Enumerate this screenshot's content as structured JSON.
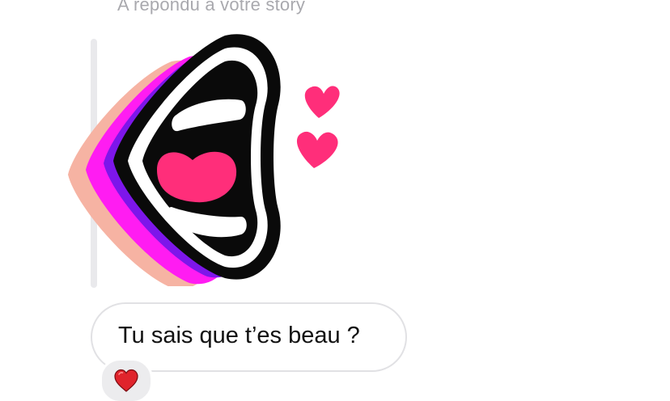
{
  "story_reply": {
    "caption": "A répondu à votre story"
  },
  "sticker": {
    "icon": "open-mouth-heart-sticker-icon",
    "colors": {
      "black": "#0a0a0a",
      "tongue": "#ff2e7a",
      "purple": "#7d16ea",
      "magenta": "#ff1cf2",
      "peach": "#f6b3a3",
      "hearts": "#ff2e7a"
    }
  },
  "message": {
    "text": "Tu sais que t’es beau ?"
  },
  "reaction": {
    "icon": "red-heart-reaction-icon",
    "color": "#e0242c"
  }
}
